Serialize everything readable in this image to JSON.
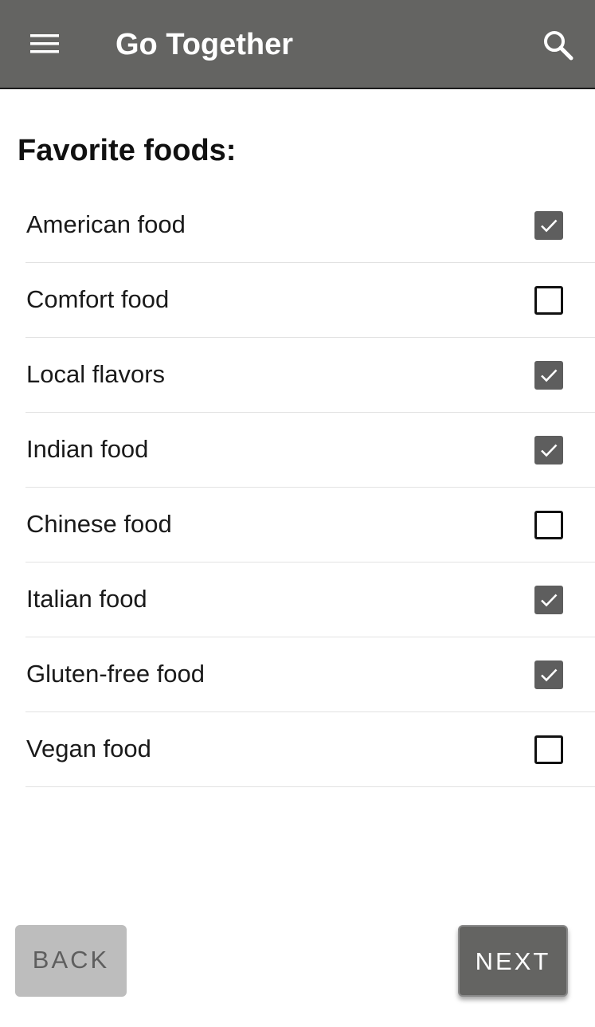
{
  "app_bar": {
    "title": "Go Together",
    "menu_icon": "hamburger-menu-icon",
    "search_icon": "search-icon"
  },
  "section_title": "Favorite foods:",
  "foods": [
    {
      "label": "American food",
      "checked": true
    },
    {
      "label": "Comfort food",
      "checked": false
    },
    {
      "label": "Local flavors",
      "checked": true
    },
    {
      "label": "Indian food",
      "checked": true
    },
    {
      "label": "Chinese food",
      "checked": false
    },
    {
      "label": "Italian food",
      "checked": true
    },
    {
      "label": "Gluten-free food",
      "checked": true
    },
    {
      "label": "Vegan food",
      "checked": false
    }
  ],
  "buttons": {
    "back": "BACK",
    "next": "NEXT"
  },
  "colors": {
    "app_bar": "#646462",
    "checked_box": "#5e5e5e",
    "back_button": "#bdbdbd",
    "next_button": "#646462"
  }
}
